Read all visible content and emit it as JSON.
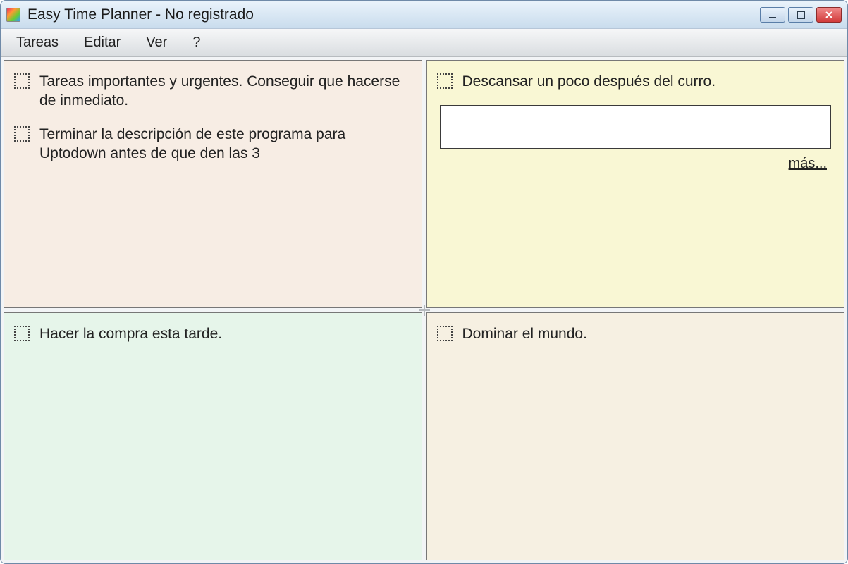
{
  "window": {
    "title": "Easy Time Planner - No registrado"
  },
  "menu": {
    "tareas": "Tareas",
    "editar": "Editar",
    "ver": "Ver",
    "help": "?"
  },
  "quadrants": {
    "q0": {
      "tasks": [
        {
          "text": "Tareas importantes y urgentes. Conseguir que hacerse de inmediato."
        },
        {
          "text": "Terminar la descripción de este programa para Uptodown antes de que den las 3"
        }
      ]
    },
    "q1": {
      "tasks": [
        {
          "text": "Descansar un poco después del curro."
        }
      ],
      "note_value": "",
      "more_label": "más..."
    },
    "q2": {
      "tasks": [
        {
          "text": "Hacer la compra esta tarde."
        }
      ]
    },
    "q3": {
      "tasks": [
        {
          "text": "Dominar el mundo."
        }
      ]
    }
  }
}
